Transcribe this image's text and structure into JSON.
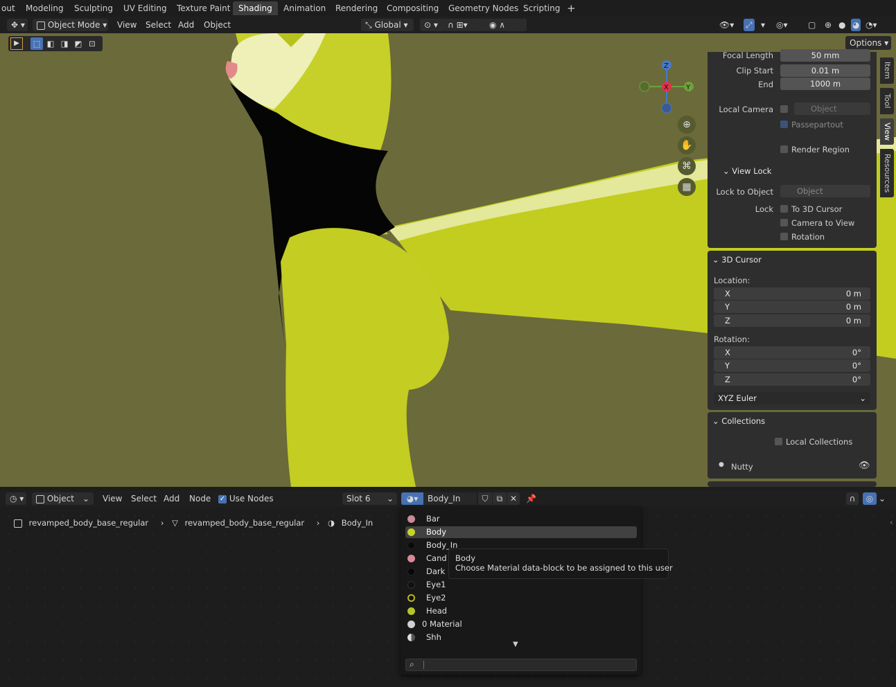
{
  "workspace_tabs": [
    "out",
    "Modeling",
    "Sculpting",
    "UV Editing",
    "Texture Paint",
    "Shading",
    "Animation",
    "Rendering",
    "Compositing",
    "Geometry Nodes",
    "Scripting",
    "+"
  ],
  "active_workspace": "Shading",
  "viewport_header": {
    "mode": "Object Mode",
    "menus": [
      "View",
      "Select",
      "Add",
      "Object"
    ],
    "orientation": "Global",
    "options_label": "Options"
  },
  "gizmo": {
    "z": "Z",
    "x": "X",
    "y": "Y"
  },
  "npanel": {
    "tabs": [
      "Item",
      "Tool",
      "View",
      "Resources"
    ],
    "active_tab": "View",
    "focal_length_label": "Focal Length",
    "focal_length": "50 mm",
    "clip_start_label": "Clip Start",
    "clip_start": "0.01 m",
    "clip_end_label": "End",
    "clip_end": "1000 m",
    "local_camera_label": "Local Camera",
    "object_placeholder": "Object",
    "passepartout": "Passepartout",
    "render_region": "Render Region",
    "view_lock_title": "View Lock",
    "lock_to_object_label": "Lock to Object",
    "lock_label": "Lock",
    "to_3d_cursor": "To 3D Cursor",
    "camera_to_view": "Camera to View",
    "rotation_lock": "Rotation",
    "cursor_title": "3D Cursor",
    "location_label": "Location:",
    "loc": [
      {
        "axis": "X",
        "value": "0 m"
      },
      {
        "axis": "Y",
        "value": "0 m"
      },
      {
        "axis": "Z",
        "value": "0 m"
      }
    ],
    "rotation_label": "Rotation:",
    "rot": [
      {
        "axis": "X",
        "value": "0°"
      },
      {
        "axis": "Y",
        "value": "0°"
      },
      {
        "axis": "Z",
        "value": "0°"
      }
    ],
    "rotation_mode": "XYZ Euler",
    "collections_title": "Collections",
    "local_collections": "Local Collections",
    "collection_name": "Nutty"
  },
  "node_header": {
    "object_dropdown": "Object",
    "menus": [
      "View",
      "Select",
      "Add",
      "Node"
    ],
    "use_nodes": "Use Nodes",
    "slot": "Slot 6",
    "material_name": "Body_In"
  },
  "breadcrumb": {
    "object": "revamped_body_base_regular",
    "mesh": "revamped_body_base_regular",
    "material": "Body_In"
  },
  "materials": [
    {
      "name": "Bar",
      "color": "#c98a99"
    },
    {
      "name": "Body",
      "color": "#c8d22a"
    },
    {
      "name": "Body_In",
      "color": "#0a0a0a"
    },
    {
      "name": "Cand",
      "color": "#d98a98"
    },
    {
      "name": "Dark",
      "color": "#060606"
    },
    {
      "name": "Eye1",
      "color": "#101010"
    },
    {
      "name": "Eye2",
      "color": "#b8b820"
    },
    {
      "name": "Head",
      "color": "#b7c22a"
    },
    {
      "name": "0 Material",
      "color": "#d0d0d0"
    },
    {
      "name": "Shh",
      "color": "#9a9a9a"
    }
  ],
  "selected_material": "Body",
  "tooltip": {
    "title": "Body",
    "description": "Choose Material data-block to be assigned to this user"
  }
}
